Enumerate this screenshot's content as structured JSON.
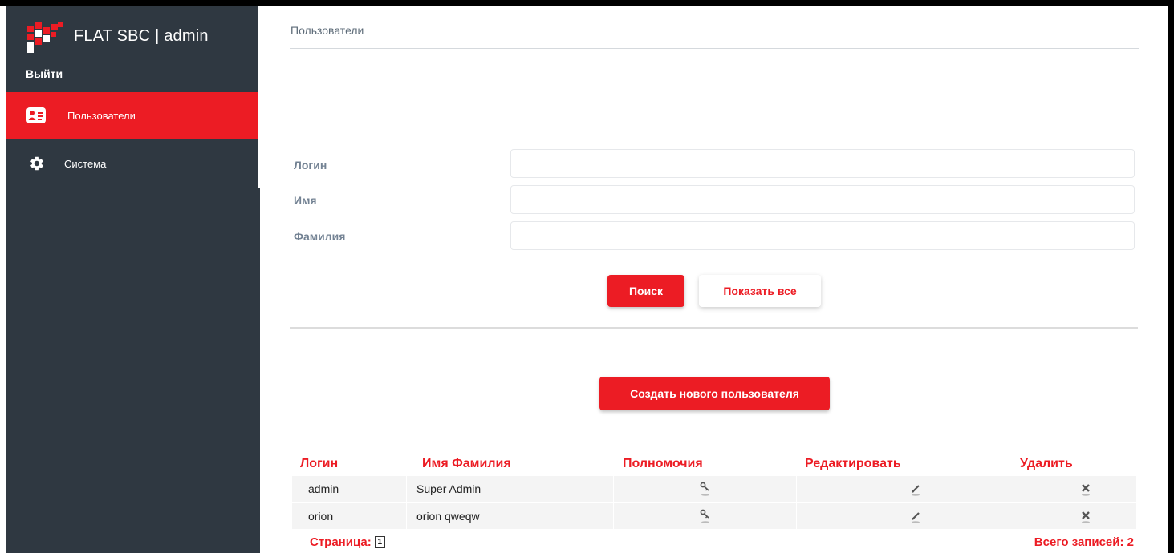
{
  "app": {
    "title": "FLAT SBC | admin",
    "logout": "Выйти"
  },
  "sidebar": {
    "items": [
      {
        "label": "Пользователи",
        "icon": "user-card-icon",
        "active": true
      },
      {
        "label": "Система",
        "icon": "gear-icon",
        "active": false
      }
    ]
  },
  "breadcrumb": "Пользователи",
  "form": {
    "login_label": "Логин",
    "login_value": "",
    "name_label": "Имя",
    "name_value": "",
    "surname_label": "Фамилия",
    "surname_value": ""
  },
  "buttons": {
    "search": "Поиск",
    "show_all": "Показать все",
    "create": "Создать нового пользователя"
  },
  "table": {
    "headers": [
      "Логин",
      "Имя Фамилия",
      "Полномочия",
      "Редактировать",
      "Удалить"
    ],
    "rows": [
      {
        "login": "admin",
        "name": "Super Admin"
      },
      {
        "login": "orion",
        "name": "orion qweqw"
      }
    ]
  },
  "footer": {
    "page_label": "Страница:",
    "page_number": "1",
    "total_label": "Всего записей: 2"
  },
  "colors": {
    "accent": "#ec1c24",
    "sidebar": "#2f3841",
    "label": "#738293"
  }
}
